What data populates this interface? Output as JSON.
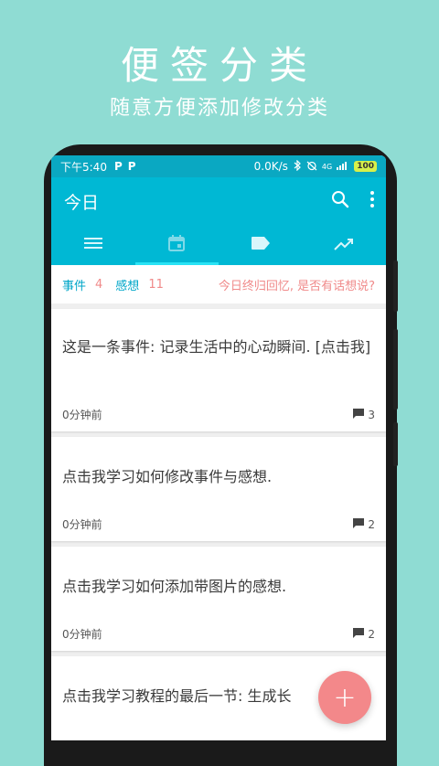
{
  "promo": {
    "title": "便签分类",
    "subtitle": "随意方便添加修改分类"
  },
  "statusbar": {
    "time": "下午5:40",
    "p1": "P",
    "p2": "P",
    "speed": "0.0K/s",
    "network": "4G",
    "battery": "100"
  },
  "appbar": {
    "title": "今日",
    "search_icon": "search-icon",
    "menu_icon": "more-vert-icon"
  },
  "tabs": [
    {
      "icon": "list-icon",
      "active": false
    },
    {
      "icon": "calendar-icon",
      "active": true
    },
    {
      "icon": "tag-icon",
      "active": false
    },
    {
      "icon": "trending-icon",
      "active": false
    }
  ],
  "summary": {
    "events_label": "事件",
    "events_count": "4",
    "thoughts_label": "感想",
    "thoughts_count": "11",
    "prompt": "今日终归回忆, 是否有话想说?"
  },
  "cards": [
    {
      "text": "这是一条事件: 记录生活中的心动瞬间. [点击我]",
      "time": "0分钟前",
      "comments": "3"
    },
    {
      "text": "点击我学习如何修改事件与感想.",
      "time": "0分钟前",
      "comments": "2"
    },
    {
      "text": "点击我学习如何添加带图片的感想.",
      "time": "0分钟前",
      "comments": "2"
    },
    {
      "text": "点击我学习教程的最后一节: 生成长",
      "time": "",
      "comments": ""
    }
  ],
  "fab": {
    "label": "+"
  },
  "colors": {
    "background": "#8fdcd3",
    "primary": "#00b8d4",
    "accent": "#f3888a"
  }
}
